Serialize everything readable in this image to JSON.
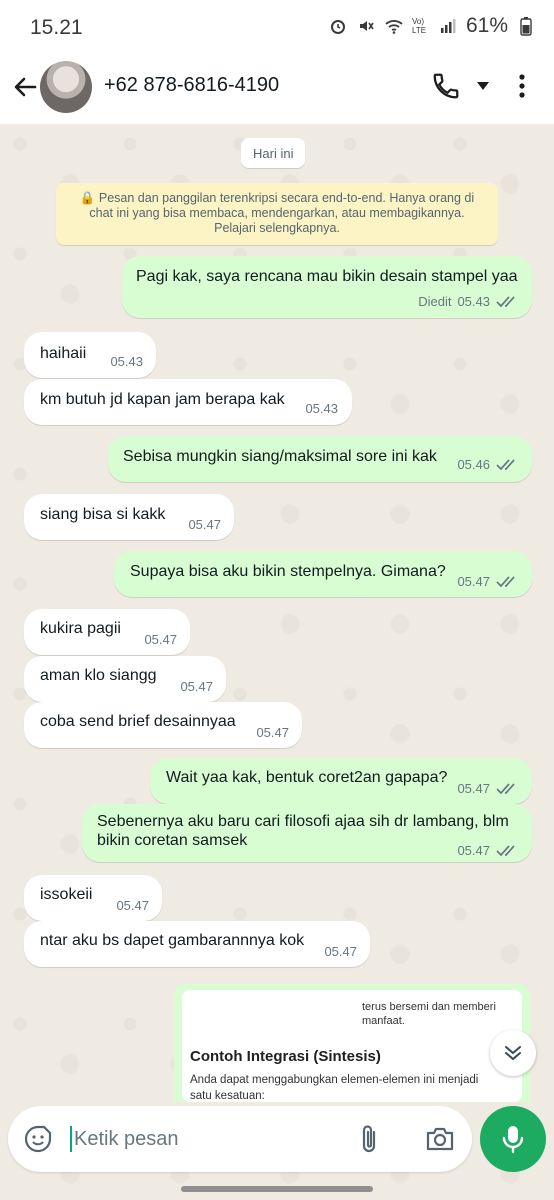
{
  "status": {
    "time": "15.21",
    "battery": "61%",
    "icons": [
      "alarm-icon",
      "mute-icon",
      "wifi-icon",
      "volte-icon",
      "signal-icon",
      "battery-icon"
    ],
    "volte_label": "Vo) LTE"
  },
  "header": {
    "contact": "+62 878-6816-4190"
  },
  "chat": {
    "date": "Hari ini",
    "encryption_notice": "🔒 Pesan dan panggilan terenkripsi secara end-to-end. Hanya orang di chat ini yang bisa membaca, mendengarkan, atau membagikannya. Pelajari selengkapnya.",
    "messages": [
      {
        "dir": "out",
        "text": "Pagi kak, saya rencana mau bikin desain stampel yaa",
        "edited": "Diedit",
        "time": "05.43"
      },
      {
        "dir": "in",
        "text": "haihaii",
        "time": "05.43"
      },
      {
        "dir": "in",
        "text": "km butuh jd kapan jam berapa kak",
        "time": "05.43"
      },
      {
        "dir": "out",
        "text": "Sebisa mungkin siang/maksimal sore ini kak",
        "time": "05.46"
      },
      {
        "dir": "in",
        "text": "siang bisa si kakk",
        "time": "05.47"
      },
      {
        "dir": "out",
        "text": "Supaya bisa aku bikin stempelnya. Gimana?",
        "time": "05.47"
      },
      {
        "dir": "in",
        "text": "kukira pagii",
        "time": "05.47"
      },
      {
        "dir": "in",
        "text": "aman klo siangg",
        "time": "05.47"
      },
      {
        "dir": "in",
        "text": "coba send brief desainnyaa",
        "time": "05.47"
      },
      {
        "dir": "out",
        "text": "Wait yaa kak, bentuk coret2an gapapa?",
        "time": "05.47"
      },
      {
        "dir": "out",
        "text": "Sebenernya aku baru cari filosofi ajaa sih dr lambang, blm bikin coretan samsek",
        "time": "05.47"
      },
      {
        "dir": "in",
        "text": "issokeii",
        "time": "05.47"
      },
      {
        "dir": "in",
        "text": "ntar aku bs dapet gambarannnya kok",
        "time": "05.47"
      }
    ],
    "preview": {
      "top_text": "terus bersemi dan memberi manfaat.",
      "title": "Contoh Integrasi (Sintesis)",
      "body": "Anda dapat menggabungkan elemen-elemen ini menjadi satu kesatuan:"
    }
  },
  "input": {
    "placeholder": "Ketik pesan"
  },
  "colors": {
    "accent": "#1daa61",
    "outgoing": "#d9fdd3",
    "incoming": "#ffffff",
    "tick": "#667781"
  }
}
